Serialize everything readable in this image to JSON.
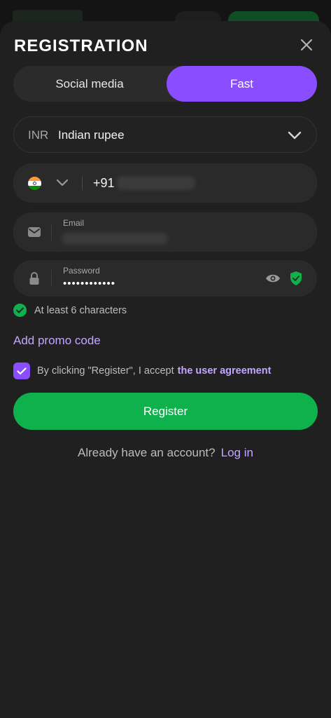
{
  "header": {
    "title": "REGISTRATION"
  },
  "tabs": [
    {
      "label": "Social media",
      "active": false
    },
    {
      "label": "Fast",
      "active": true
    }
  ],
  "currency": {
    "code": "INR",
    "name": "Indian rupee"
  },
  "phone": {
    "country_icon": "india-flag-icon",
    "prefix": "+91"
  },
  "email": {
    "label": "Email"
  },
  "password": {
    "label": "Password",
    "value_masked": "••••••••••••"
  },
  "hint": {
    "text": "At least 6 characters"
  },
  "promo": {
    "label": "Add promo code"
  },
  "agreement": {
    "text": "By clicking \"Register\", I accept",
    "link": "the user agreement",
    "checked": true
  },
  "register": {
    "label": "Register"
  },
  "login": {
    "question": "Already have an account?",
    "link": "Log in"
  },
  "colors": {
    "accent_purple": "#8a4dff",
    "accent_green": "#0fb14d",
    "link_purple": "#c3a7ff",
    "background": "#202020"
  }
}
